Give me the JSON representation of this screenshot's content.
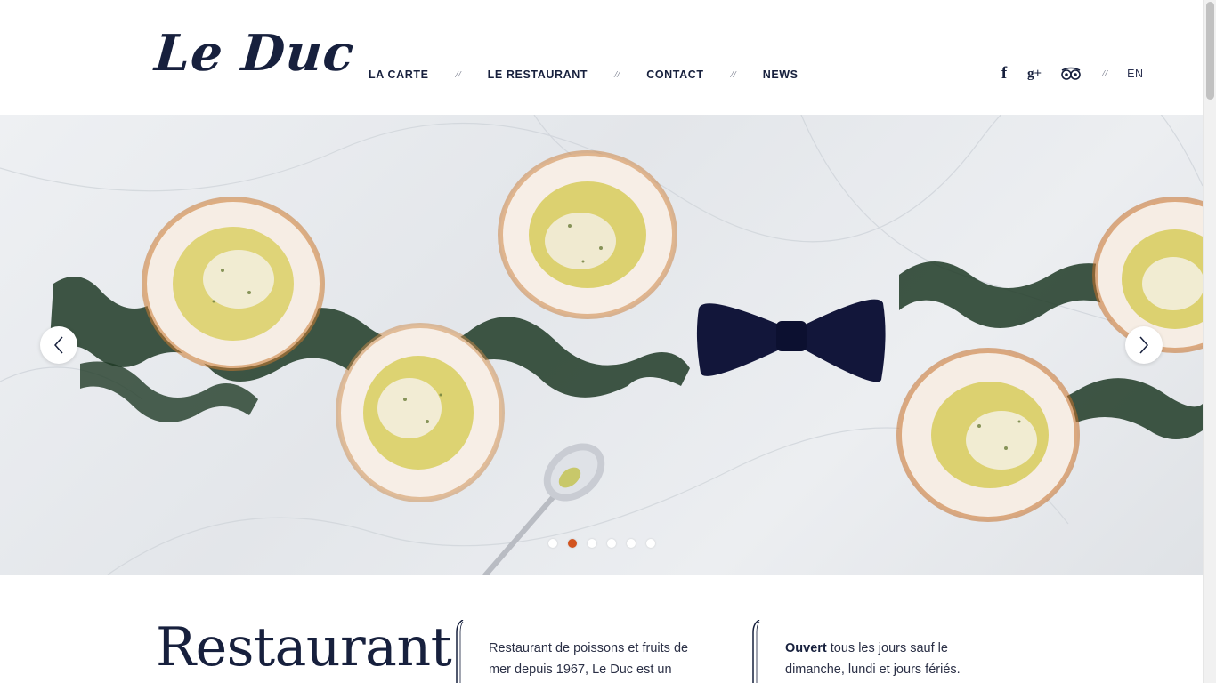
{
  "header": {
    "logo_text": "Le Duc",
    "nav": [
      {
        "label": "LA CARTE"
      },
      {
        "label": "LE RESTAURANT"
      },
      {
        "label": "CONTACT"
      },
      {
        "label": "NEWS"
      }
    ],
    "nav_separator": "//",
    "social": {
      "facebook_icon": "facebook-icon",
      "googleplus_icon": "google-plus-icon",
      "tripadvisor_icon": "tripadvisor-icon"
    },
    "lang": "EN"
  },
  "slider": {
    "prev_icon": "chevron-left-icon",
    "next_icon": "chevron-right-icon",
    "dots_count": 6,
    "active_index": 1,
    "accent": "#d2531e"
  },
  "content": {
    "title": "Restaurant",
    "col1": "Restaurant de poissons et fruits de mer depuis 1967, Le Duc est un",
    "col2_bold": "Ouvert",
    "col2_rest": " tous les jours sauf le dimanche, lundi et jours fériés."
  },
  "colors": {
    "navy": "#17203d",
    "accent": "#d2531e"
  }
}
